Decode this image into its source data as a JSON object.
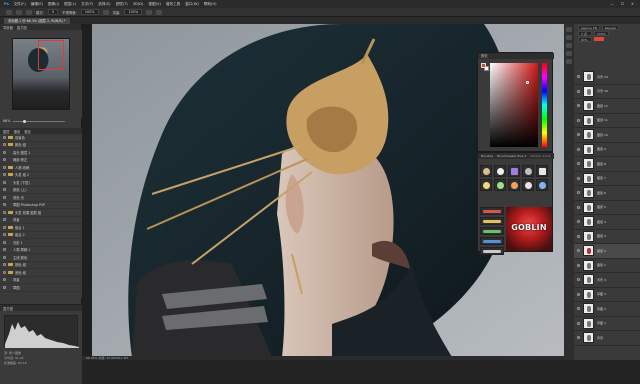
{
  "menubar": {
    "items": [
      "文件(F)",
      "编辑(E)",
      "图像(I)",
      "图层(L)",
      "文字(Y)",
      "选择(S)",
      "滤镜(T)",
      "3D(D)",
      "视图(V)",
      "增效工具",
      "窗口(W)",
      "帮助(H)"
    ],
    "window_controls": [
      "—",
      "☐",
      "✕"
    ]
  },
  "options": {
    "fields": [
      "100%",
      "0",
      "100%"
    ],
    "labels": [
      "模式:",
      "不透明度:",
      "流量:"
    ]
  },
  "tabs": [
    "未标题-1 @ 66.3% (图层 2, RGB/8) *"
  ],
  "navigator": {
    "tabs": [
      "导航器",
      "直方图"
    ],
    "zoom": "66%"
  },
  "layers_panel": {
    "tabs": [
      "图层",
      "通道",
      "路径"
    ],
    "rows": [
      {
        "label": "前景色",
        "type": "folder"
      },
      {
        "label": "颜色 组",
        "type": "folder"
      },
      {
        "label": "高光 图层 1",
        "type": "layer"
      },
      {
        "label": "暗部 修正",
        "type": "layer"
      },
      {
        "label": "人物 线稿",
        "type": "folder"
      },
      {
        "label": "头发 组 2",
        "type": "folder"
      },
      {
        "label": "头发 (下层)",
        "type": "layer"
      },
      {
        "label": "肤色 (上)",
        "type": "layer"
      },
      {
        "label": "底色 光",
        "type": "layer"
      },
      {
        "label": "草图 Photoshop PSP",
        "type": "layer"
      },
      {
        "label": "头发 效果 图层 组",
        "type": "folder"
      },
      {
        "label": "背景",
        "type": "layer"
      },
      {
        "label": "组合 1",
        "type": "folder"
      },
      {
        "label": "组合 2",
        "type": "folder"
      },
      {
        "label": "光影 1",
        "type": "layer"
      },
      {
        "label": "人物 草稿 1",
        "type": "layer"
      },
      {
        "label": "主线 颜色",
        "type": "layer"
      },
      {
        "label": "肤色 组",
        "type": "folder"
      },
      {
        "label": "底色 组",
        "type": "folder"
      },
      {
        "label": "背景",
        "type": "layer"
      },
      {
        "label": "草图",
        "type": "layer"
      }
    ]
  },
  "histogram": {
    "title": "直方图",
    "info": [
      "源: 整个图像",
      "平均值: 91.22",
      "标准偏差: 60.18"
    ]
  },
  "status": "66.26%   文档: 22.6M/541.3M",
  "color_panel": {
    "title": "颜色",
    "fg_color": "#d6483b",
    "bg_color": "#ffffff"
  },
  "brush_panel": {
    "tabs": [
      "Brushes",
      "Brushmaster Plus 2",
      "Toolbox 3.0.8"
    ],
    "goblin_label": "GOBLIN"
  },
  "properties": {
    "rows": [
      "Agency FB",
      "Regular",
      "3 点",
      "100%",
      "60%"
    ],
    "accent": "#e0463b"
  },
  "right_layers": {
    "rows": [
      "背景 24",
      "背景 18",
      "图层 12",
      "图层 11",
      "图层 10",
      "图层 9",
      "图层 8",
      "图层 7",
      "图层 6",
      "图层 5",
      "图层 4",
      "图层 3",
      "图层 2",
      "图层 1",
      "背景 4",
      "草图 3",
      "草图 2",
      "草图 1",
      "背景"
    ],
    "selected_index": 12
  }
}
